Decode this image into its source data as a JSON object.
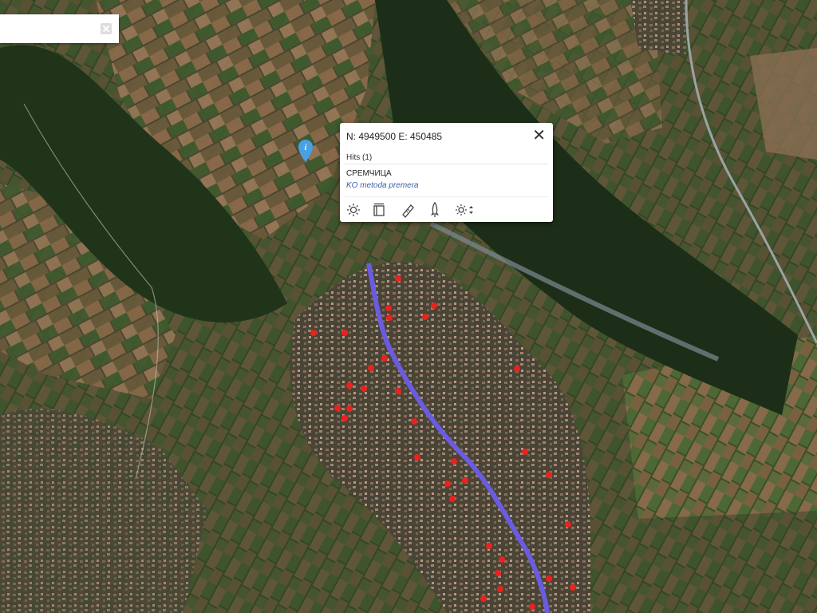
{
  "search": {
    "value": "",
    "placeholder": ""
  },
  "popup": {
    "coords": "N: 4949500 E: 450485",
    "hits": "Hits (1)",
    "name": "СРЕМЧИЦА",
    "link": "KO metoda premera",
    "tools": [
      "brightness-icon",
      "layers-toggle-icon",
      "ruler-icon",
      "rocket-icon",
      "brightness-dropdown-icon"
    ]
  },
  "map": {
    "marker_color": "#e8231f",
    "route_color": "#6a5ce0",
    "info_marker_color": "#4aa0e4"
  }
}
